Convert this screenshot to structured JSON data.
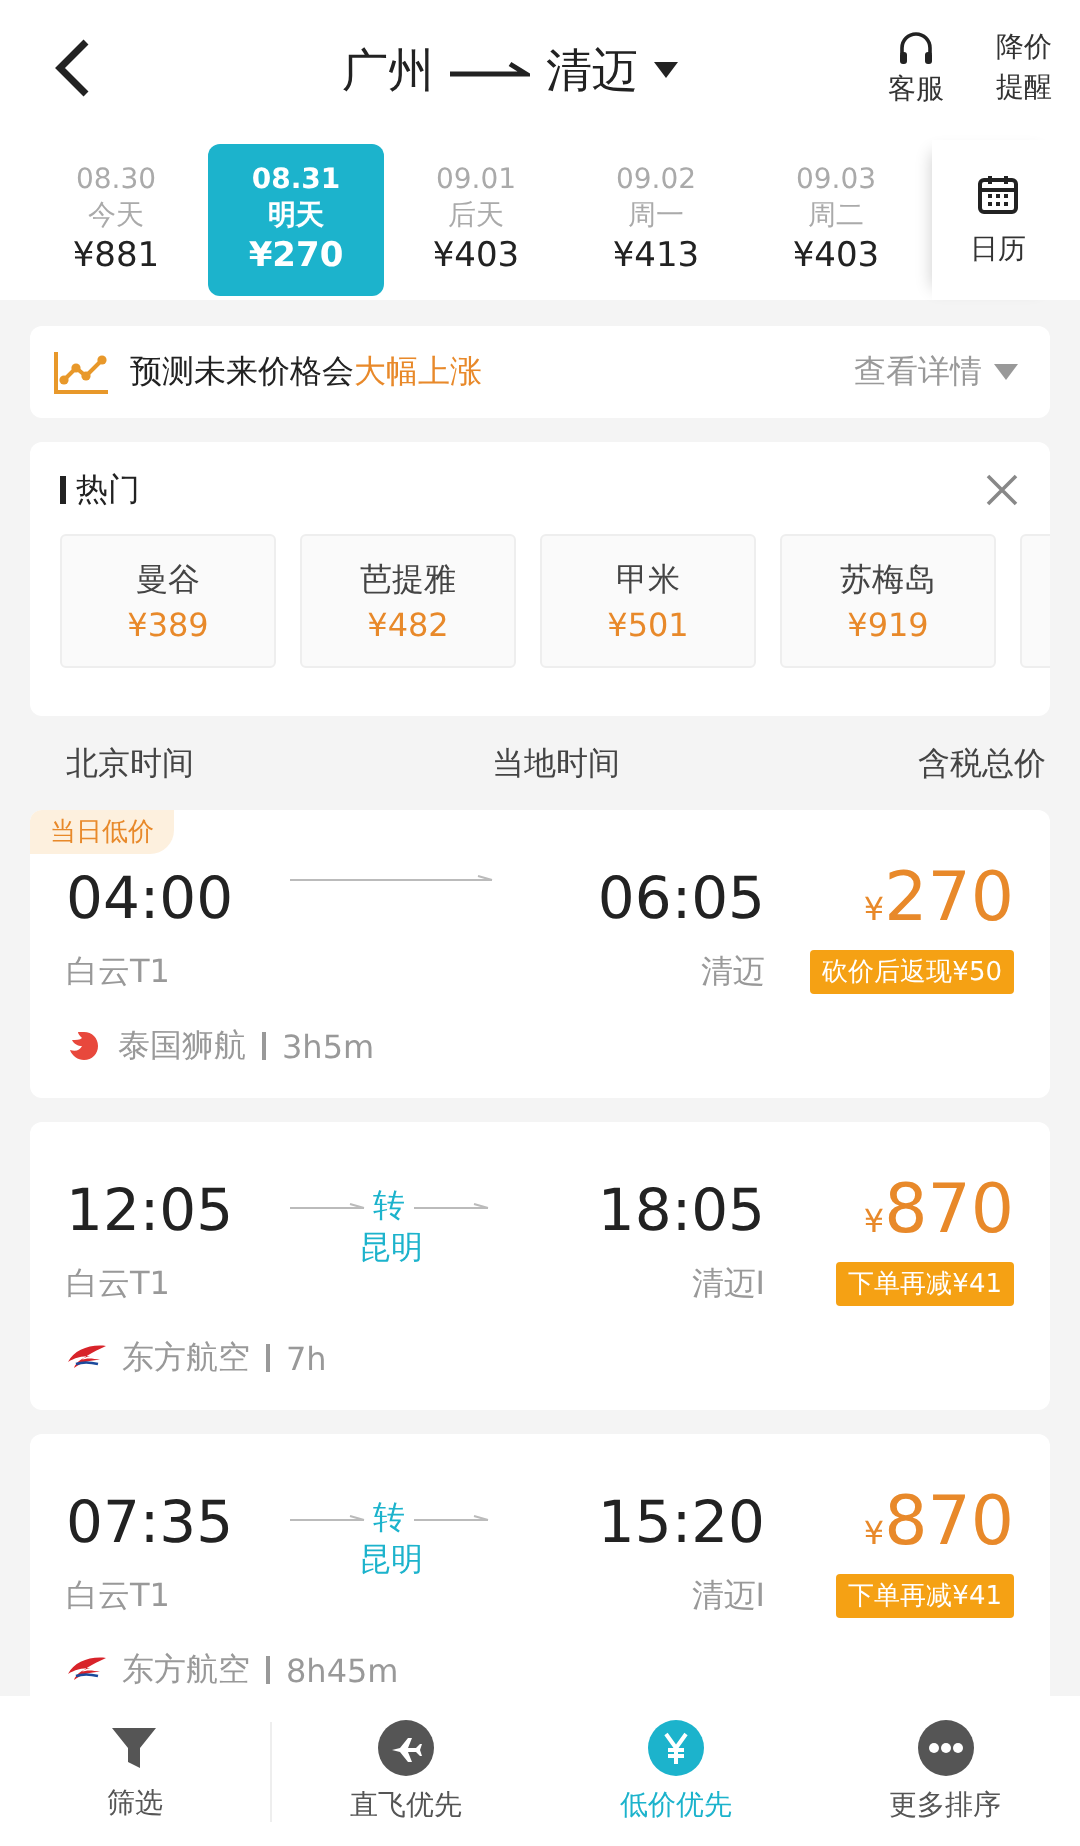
{
  "header": {
    "from": "广州",
    "to": "清迈",
    "actions": [
      {
        "kind": "service",
        "label": "客服"
      },
      {
        "kind": "alert",
        "label": "降价提醒"
      }
    ]
  },
  "dates": [
    {
      "date": "08.30",
      "day": "今天",
      "price": "¥881",
      "selected": false
    },
    {
      "date": "08.31",
      "day": "明天",
      "price": "¥270",
      "selected": true
    },
    {
      "date": "09.01",
      "day": "后天",
      "price": "¥403",
      "selected": false
    },
    {
      "date": "09.02",
      "day": "周一",
      "price": "¥413",
      "selected": false
    },
    {
      "date": "09.03",
      "day": "周二",
      "price": "¥403",
      "selected": false
    }
  ],
  "calendar_label": "日历",
  "forecast": {
    "text": "预测未来价格会**大幅上涨**",
    "link": "查看详情"
  },
  "hot": {
    "title": "热门",
    "items": [
      {
        "city": "曼谷",
        "price": "¥389"
      },
      {
        "city": "芭提雅",
        "price": "¥482"
      },
      {
        "city": "甲米",
        "price": "¥501"
      },
      {
        "city": "苏梅岛",
        "price": "¥919"
      }
    ]
  },
  "columns": [
    "北京时间",
    "当地时间",
    "含税总价"
  ],
  "flights": [
    {
      "tag": "当日低价",
      "depart": "04:00",
      "arrive": "06:05",
      "from_airport": "白云T1",
      "to_airport": "清迈",
      "currency": "¥",
      "price": "270",
      "promo": "砍价后返现¥50",
      "airline": "泰国狮航",
      "kind": "lion",
      "duration": "3h5m"
    },
    {
      "depart": "12:05",
      "arrive": "18:05",
      "from_airport": "白云T1",
      "to_airport": "清迈I",
      "transfer": {
        "label": "转",
        "city": "昆明"
      },
      "currency": "¥",
      "price": "870",
      "promo": "下单再减¥41",
      "airline": "东方航空",
      "kind": "swallow",
      "duration": "7h"
    },
    {
      "depart": "07:35",
      "arrive": "15:20",
      "from_airport": "白云T1",
      "to_airport": "清迈I",
      "transfer": {
        "label": "转",
        "city": "昆明"
      },
      "currency": "¥",
      "price": "870",
      "promo": "下单再减¥41",
      "airline": "东方航空",
      "kind": "swallow",
      "duration": "8h45m"
    }
  ],
  "bottom_nav": [
    {
      "kind": "filter",
      "label": "筛选",
      "selected": false
    },
    {
      "kind": "direct",
      "label": "直飞优先",
      "selected": false
    },
    {
      "kind": "price",
      "label": "低价优先",
      "selected": true
    },
    {
      "kind": "more",
      "label": "更多排序",
      "selected": false
    }
  ]
}
